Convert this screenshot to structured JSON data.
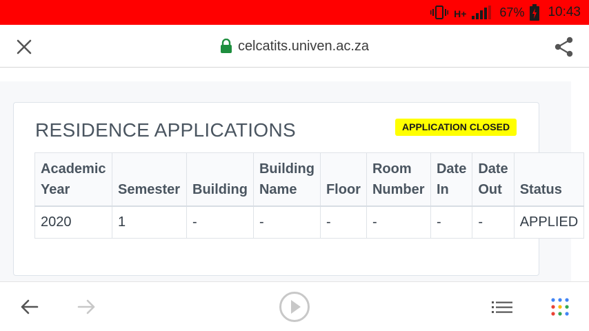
{
  "status_bar": {
    "network_type": "H+",
    "battery_percent": "67%",
    "time": "10:43",
    "icons": [
      "vibrate-icon",
      "signal-icon",
      "battery-charging-icon"
    ]
  },
  "browser": {
    "url": "celcatits.univen.ac.za",
    "icons": [
      "close-icon",
      "lock-icon",
      "share-icon"
    ]
  },
  "card": {
    "title": "RESIDENCE APPLICATIONS",
    "badge": "APPLICATION CLOSED",
    "badge_color": "#ffff00"
  },
  "table": {
    "columns": [
      {
        "line1": "Academic",
        "line2": "Year"
      },
      {
        "line1": "",
        "line2": "Semester"
      },
      {
        "line1": "",
        "line2": "Building"
      },
      {
        "line1": "Building",
        "line2": "Name"
      },
      {
        "line1": "",
        "line2": "Floor"
      },
      {
        "line1": "Room",
        "line2": "Number"
      },
      {
        "line1": "Date",
        "line2": "In"
      },
      {
        "line1": "Date",
        "line2": "Out"
      },
      {
        "line1": "",
        "line2": "Status"
      }
    ],
    "rows": [
      [
        "2020",
        "1",
        "-",
        "-",
        "-",
        "-",
        "-",
        "-",
        "APPLIED"
      ]
    ]
  },
  "bottom_bar": {
    "icons": [
      "back-arrow-icon",
      "forward-arrow-icon",
      "play-icon",
      "menu-icon",
      "apps-grid-icon"
    ]
  },
  "colors": {
    "status_bar": "#ff0000",
    "lock": "#1e8e3e"
  }
}
